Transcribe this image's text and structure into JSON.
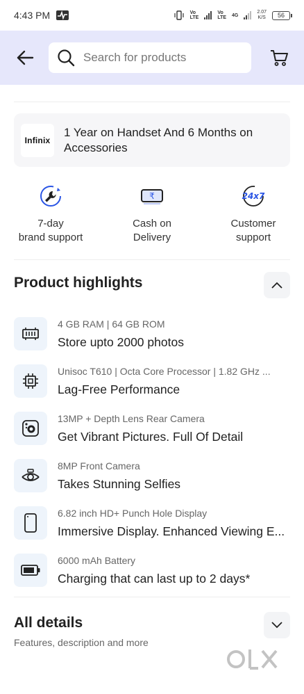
{
  "status_bar": {
    "time": "4:43 PM",
    "volte1": [
      "Vo",
      "LTE"
    ],
    "volte2": [
      "Vo",
      "LTE"
    ],
    "network": "4G",
    "speed_value": "2.07",
    "speed_unit": "K/S",
    "battery": "56"
  },
  "header": {
    "search_placeholder": "Search for products"
  },
  "warranty": {
    "brand": "Infinix",
    "text": "1 Year on Handset And 6 Months on Accessories"
  },
  "features": [
    {
      "label": "7-day\nbrand support",
      "icon": "wrench-icon"
    },
    {
      "label": "Cash on\nDelivery",
      "icon": "rupee-note-icon"
    },
    {
      "label": "Customer\nsupport",
      "icon": "24x7-icon"
    }
  ],
  "highlights": {
    "title": "Product highlights",
    "items": [
      {
        "sub": "4 GB RAM | 64 GB ROM",
        "main": "Store upto 2000 photos",
        "icon": "memory-icon"
      },
      {
        "sub": "Unisoc T610 | Octa Core Processor | 1.82 GHz ...",
        "main": "Lag-Free Performance",
        "icon": "processor-icon"
      },
      {
        "sub": "13MP + Depth Lens Rear Camera",
        "main": "Get Vibrant Pictures. Full Of Detail",
        "icon": "rear-camera-icon"
      },
      {
        "sub": "8MP Front Camera",
        "main": "Takes Stunning Selfies",
        "icon": "front-camera-icon"
      },
      {
        "sub": "6.82 inch HD+ Punch Hole Display",
        "main": "Immersive Display. Enhanced Viewing E...",
        "icon": "display-icon"
      },
      {
        "sub": "6000 mAh Battery",
        "main": "Charging that can last up to 2 days*",
        "icon": "battery-icon"
      }
    ]
  },
  "all_details": {
    "title": "All details",
    "subtitle": "Features, description and more"
  },
  "watermark": "OLX",
  "colors": {
    "header_bg": "#e6e7fb",
    "icon_tile_bg": "#eef4fb",
    "accent_blue": "#2a55e5"
  }
}
